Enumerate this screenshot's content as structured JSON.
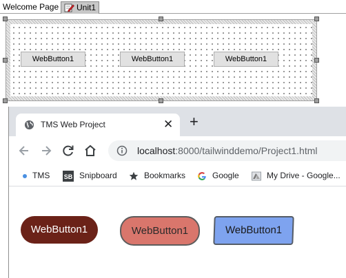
{
  "ide": {
    "tabs": [
      {
        "label": "Welcome Page",
        "icon": ""
      },
      {
        "label": "Unit1",
        "icon": "edit-form-icon"
      }
    ],
    "form": {
      "buttons": [
        "WebButton1",
        "WebButton1",
        "WebButton1"
      ]
    }
  },
  "browser": {
    "tab": {
      "title": "TMS Web Project",
      "icon": "globe-icon"
    },
    "url": {
      "host": "localhost",
      "rest": ":8000/tailwinddemo/Project1.html"
    },
    "bookmarks": [
      {
        "label": "TMS",
        "icon": "dot-icon"
      },
      {
        "label": "Snipboard",
        "icon": "sb-logo-icon"
      },
      {
        "label": "Bookmarks",
        "icon": "star-icon"
      },
      {
        "label": "Google",
        "icon": "google-icon"
      },
      {
        "label": "My Drive - Google...",
        "icon": "drive-icon"
      }
    ],
    "page": {
      "buttons": [
        {
          "label": "WebButton1",
          "color": "#6b2218"
        },
        {
          "label": "WebButton1",
          "color": "#d9766c"
        },
        {
          "label": "WebButton1",
          "color": "#7ea3ef"
        }
      ]
    }
  }
}
